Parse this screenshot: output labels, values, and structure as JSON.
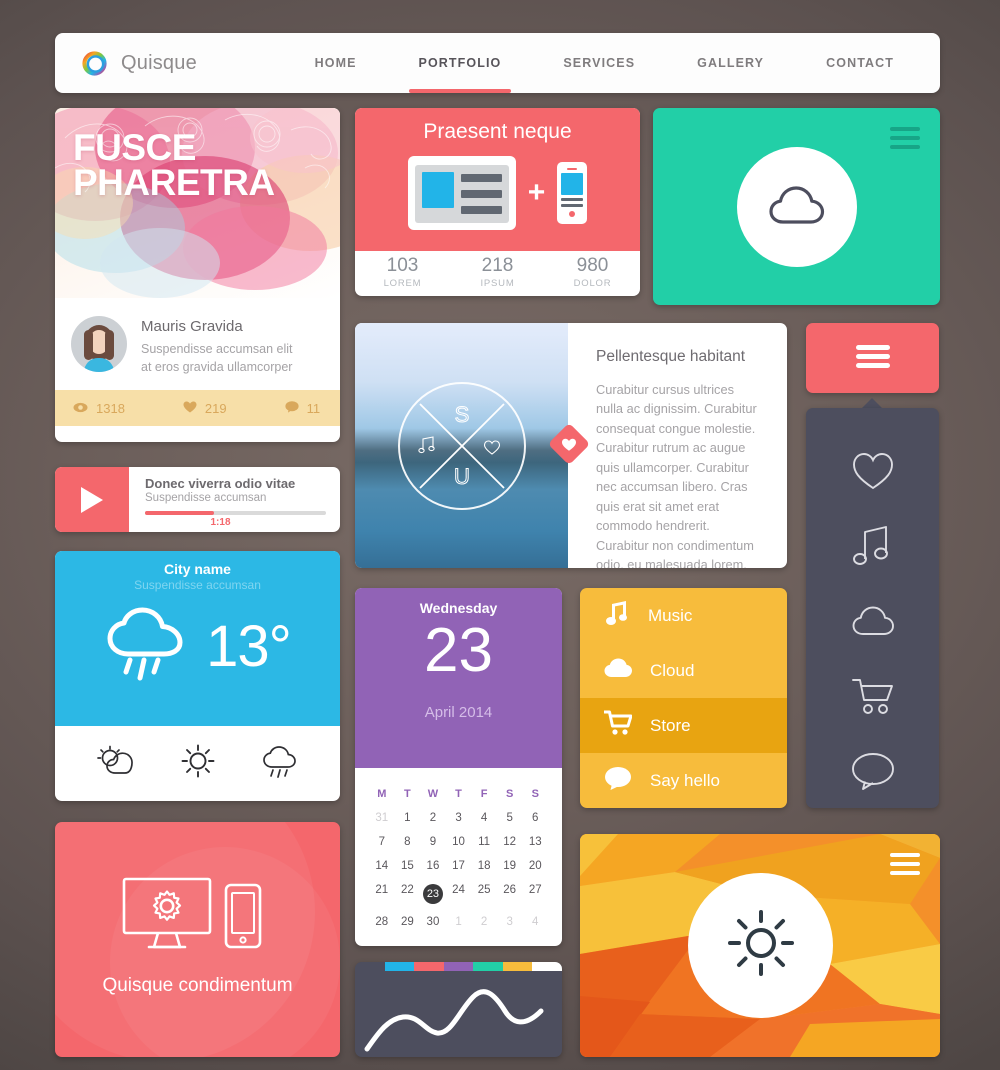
{
  "navbar": {
    "brand": "Quisque",
    "logo_icon": "rainbow-ring-logo",
    "links": [
      {
        "label": "HOME",
        "active": false
      },
      {
        "label": "PORTFOLIO",
        "active": true
      },
      {
        "label": "SERVICES",
        "active": false
      },
      {
        "label": "GALLERY",
        "active": false
      },
      {
        "label": "CONTACT",
        "active": false
      }
    ]
  },
  "profile_card": {
    "title_line1": "FUSCE",
    "title_line2": "PHARETRA",
    "name": "Mauris Gravida",
    "desc_line1": "Suspendisse accumsan elit",
    "desc_line2": "at eros gravida ullamcorper",
    "stats": [
      {
        "icon": "eye-icon",
        "value": "1318"
      },
      {
        "icon": "heart-icon",
        "value": "219"
      },
      {
        "icon": "comment-icon",
        "value": "11"
      }
    ],
    "stats_bg": "#f7dfa8",
    "stats_fg": "#d9a85c"
  },
  "praesent_card": {
    "title": "Praesent neque",
    "plus": "+",
    "bg": "#f4676c",
    "stats": [
      {
        "number": "103",
        "label": "LOREM"
      },
      {
        "number": "218",
        "label": "IPSUM"
      },
      {
        "number": "980",
        "label": "DOLOR"
      }
    ]
  },
  "cloud_card": {
    "bg": "#22cfa7",
    "icon": "cloud-icon",
    "menu_icon": "hamburger-icon"
  },
  "pellentesque_card": {
    "heading": "Pellentesque habitant",
    "body": "Curabitur cursus ultrices nulla ac dignissim. Curabitur consequat congue molestie. Curabitur rutrum ac augue quis ullamcorper. Curabitur nec accumsan libero. Cras quis erat sit amet erat commodo hendrerit. Curabitur non condimentum odio, eu malesuada lorem. Suspendisse tincidunt est felis.",
    "badge_icon": "heart-icon",
    "monogram": {
      "top": "S",
      "bottom": "U",
      "left": "music-note-icon",
      "right": "heart-icon"
    }
  },
  "sidebar": {
    "button_icon": "hamburger-icon",
    "button_bg": "#f4676c",
    "panel_bg": "#4d4e5e",
    "items": [
      {
        "icon": "heart-icon"
      },
      {
        "icon": "music-note-icon"
      },
      {
        "icon": "cloud-icon"
      },
      {
        "icon": "shopping-cart-icon"
      },
      {
        "icon": "speech-bubble-icon"
      }
    ]
  },
  "player_card": {
    "play_icon": "play-icon",
    "title": "Donec viverra odio vitae",
    "subtitle": "Suspendisse accumsan",
    "time": "1:18",
    "progress_percent": 38,
    "accent": "#f4676c"
  },
  "weather_card": {
    "city": "City name",
    "subtitle": "Suspendisse accumsan",
    "temperature": "13°",
    "condition_icon": "rain-cloud-icon",
    "bg": "#2cb8e5",
    "forecast": [
      {
        "icon": "sun-cloud-icon"
      },
      {
        "icon": "sun-icon"
      },
      {
        "icon": "rain-cloud-icon"
      }
    ]
  },
  "calendar_card": {
    "weekday": "Wednesday",
    "day": "23",
    "month_year": "April 2014",
    "bg": "#9163b6",
    "day_headers": [
      "M",
      "T",
      "W",
      "T",
      "F",
      "S",
      "S"
    ],
    "weeks": [
      [
        {
          "d": "31",
          "muted": true
        },
        {
          "d": "1"
        },
        {
          "d": "2"
        },
        {
          "d": "3"
        },
        {
          "d": "4"
        },
        {
          "d": "5"
        },
        {
          "d": "6"
        }
      ],
      [
        {
          "d": "7"
        },
        {
          "d": "8"
        },
        {
          "d": "9"
        },
        {
          "d": "10"
        },
        {
          "d": "11"
        },
        {
          "d": "12"
        },
        {
          "d": "13"
        }
      ],
      [
        {
          "d": "14"
        },
        {
          "d": "15"
        },
        {
          "d": "16"
        },
        {
          "d": "17"
        },
        {
          "d": "18"
        },
        {
          "d": "19"
        },
        {
          "d": "20"
        }
      ],
      [
        {
          "d": "21"
        },
        {
          "d": "22"
        },
        {
          "d": "23",
          "today": true
        },
        {
          "d": "24"
        },
        {
          "d": "25"
        },
        {
          "d": "26"
        },
        {
          "d": "27"
        }
      ],
      [
        {
          "d": "28"
        },
        {
          "d": "29"
        },
        {
          "d": "30"
        },
        {
          "d": "1",
          "muted": true
        },
        {
          "d": "2",
          "muted": true
        },
        {
          "d": "3",
          "muted": true
        },
        {
          "d": "4",
          "muted": true
        }
      ]
    ]
  },
  "menu_list": {
    "bg": "#f7bc3c",
    "active_bg": "#e8a411",
    "items": [
      {
        "label": "Music",
        "icon": "music-note-icon",
        "active": false
      },
      {
        "label": "Cloud",
        "icon": "cloud-icon",
        "active": false
      },
      {
        "label": "Store",
        "icon": "shopping-cart-icon",
        "active": true
      },
      {
        "label": "Say hello",
        "icon": "speech-bubble-icon",
        "active": false
      }
    ]
  },
  "condimentum_card": {
    "label": "Quisque condimentum",
    "bg": "#f4676c",
    "icons": [
      "monitor-gear-icon",
      "phone-icon"
    ]
  },
  "chart_card": {
    "bg": "#4d4e5e",
    "segment_colors": [
      "#4d4e5e",
      "#22b4e8",
      "#f4676c",
      "#9163b6",
      "#22cfa7",
      "#f7bc3c",
      "#ffffff"
    ],
    "line_color": "#ffffff"
  },
  "chart_data": {
    "type": "line",
    "title": "",
    "xlabel": "",
    "ylabel": "",
    "x": [
      0,
      1,
      2,
      3,
      4,
      5,
      6,
      7,
      8,
      9,
      10
    ],
    "values": [
      8,
      34,
      52,
      50,
      36,
      30,
      44,
      72,
      48,
      34,
      44
    ],
    "ylim": [
      0,
      80
    ],
    "grid": false,
    "legend": "none",
    "categories": [
      "slate",
      "blue",
      "red",
      "purple",
      "green",
      "yellow",
      "white"
    ]
  },
  "sun_card": {
    "bg": "#f4902a",
    "icon": "sun-icon",
    "menu_icon": "hamburger-icon"
  }
}
